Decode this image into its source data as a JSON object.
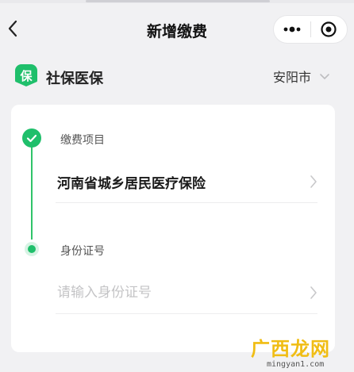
{
  "navbar": {
    "title": "新增缴费",
    "back_icon": "chevron-left-icon",
    "more_icon": "more-dots-icon",
    "close_icon": "target-close-icon"
  },
  "category": {
    "logo_text": "保",
    "name": "社保医保",
    "city": "安阳市",
    "city_icon": "chevron-down-icon"
  },
  "steps": [
    {
      "label": "缴费项目",
      "value": "河南省城乡居民医疗保险",
      "status": "completed"
    },
    {
      "label": "身份证号",
      "value": "",
      "placeholder": "请输入身份证号",
      "status": "active"
    }
  ],
  "colors": {
    "accent": "#1fbf6b",
    "background": "#f1f1f3",
    "card": "#ffffff",
    "watermark": "#f0bd14"
  },
  "watermark": {
    "brand": "广西龙网",
    "domain": "mingyan1.com"
  }
}
